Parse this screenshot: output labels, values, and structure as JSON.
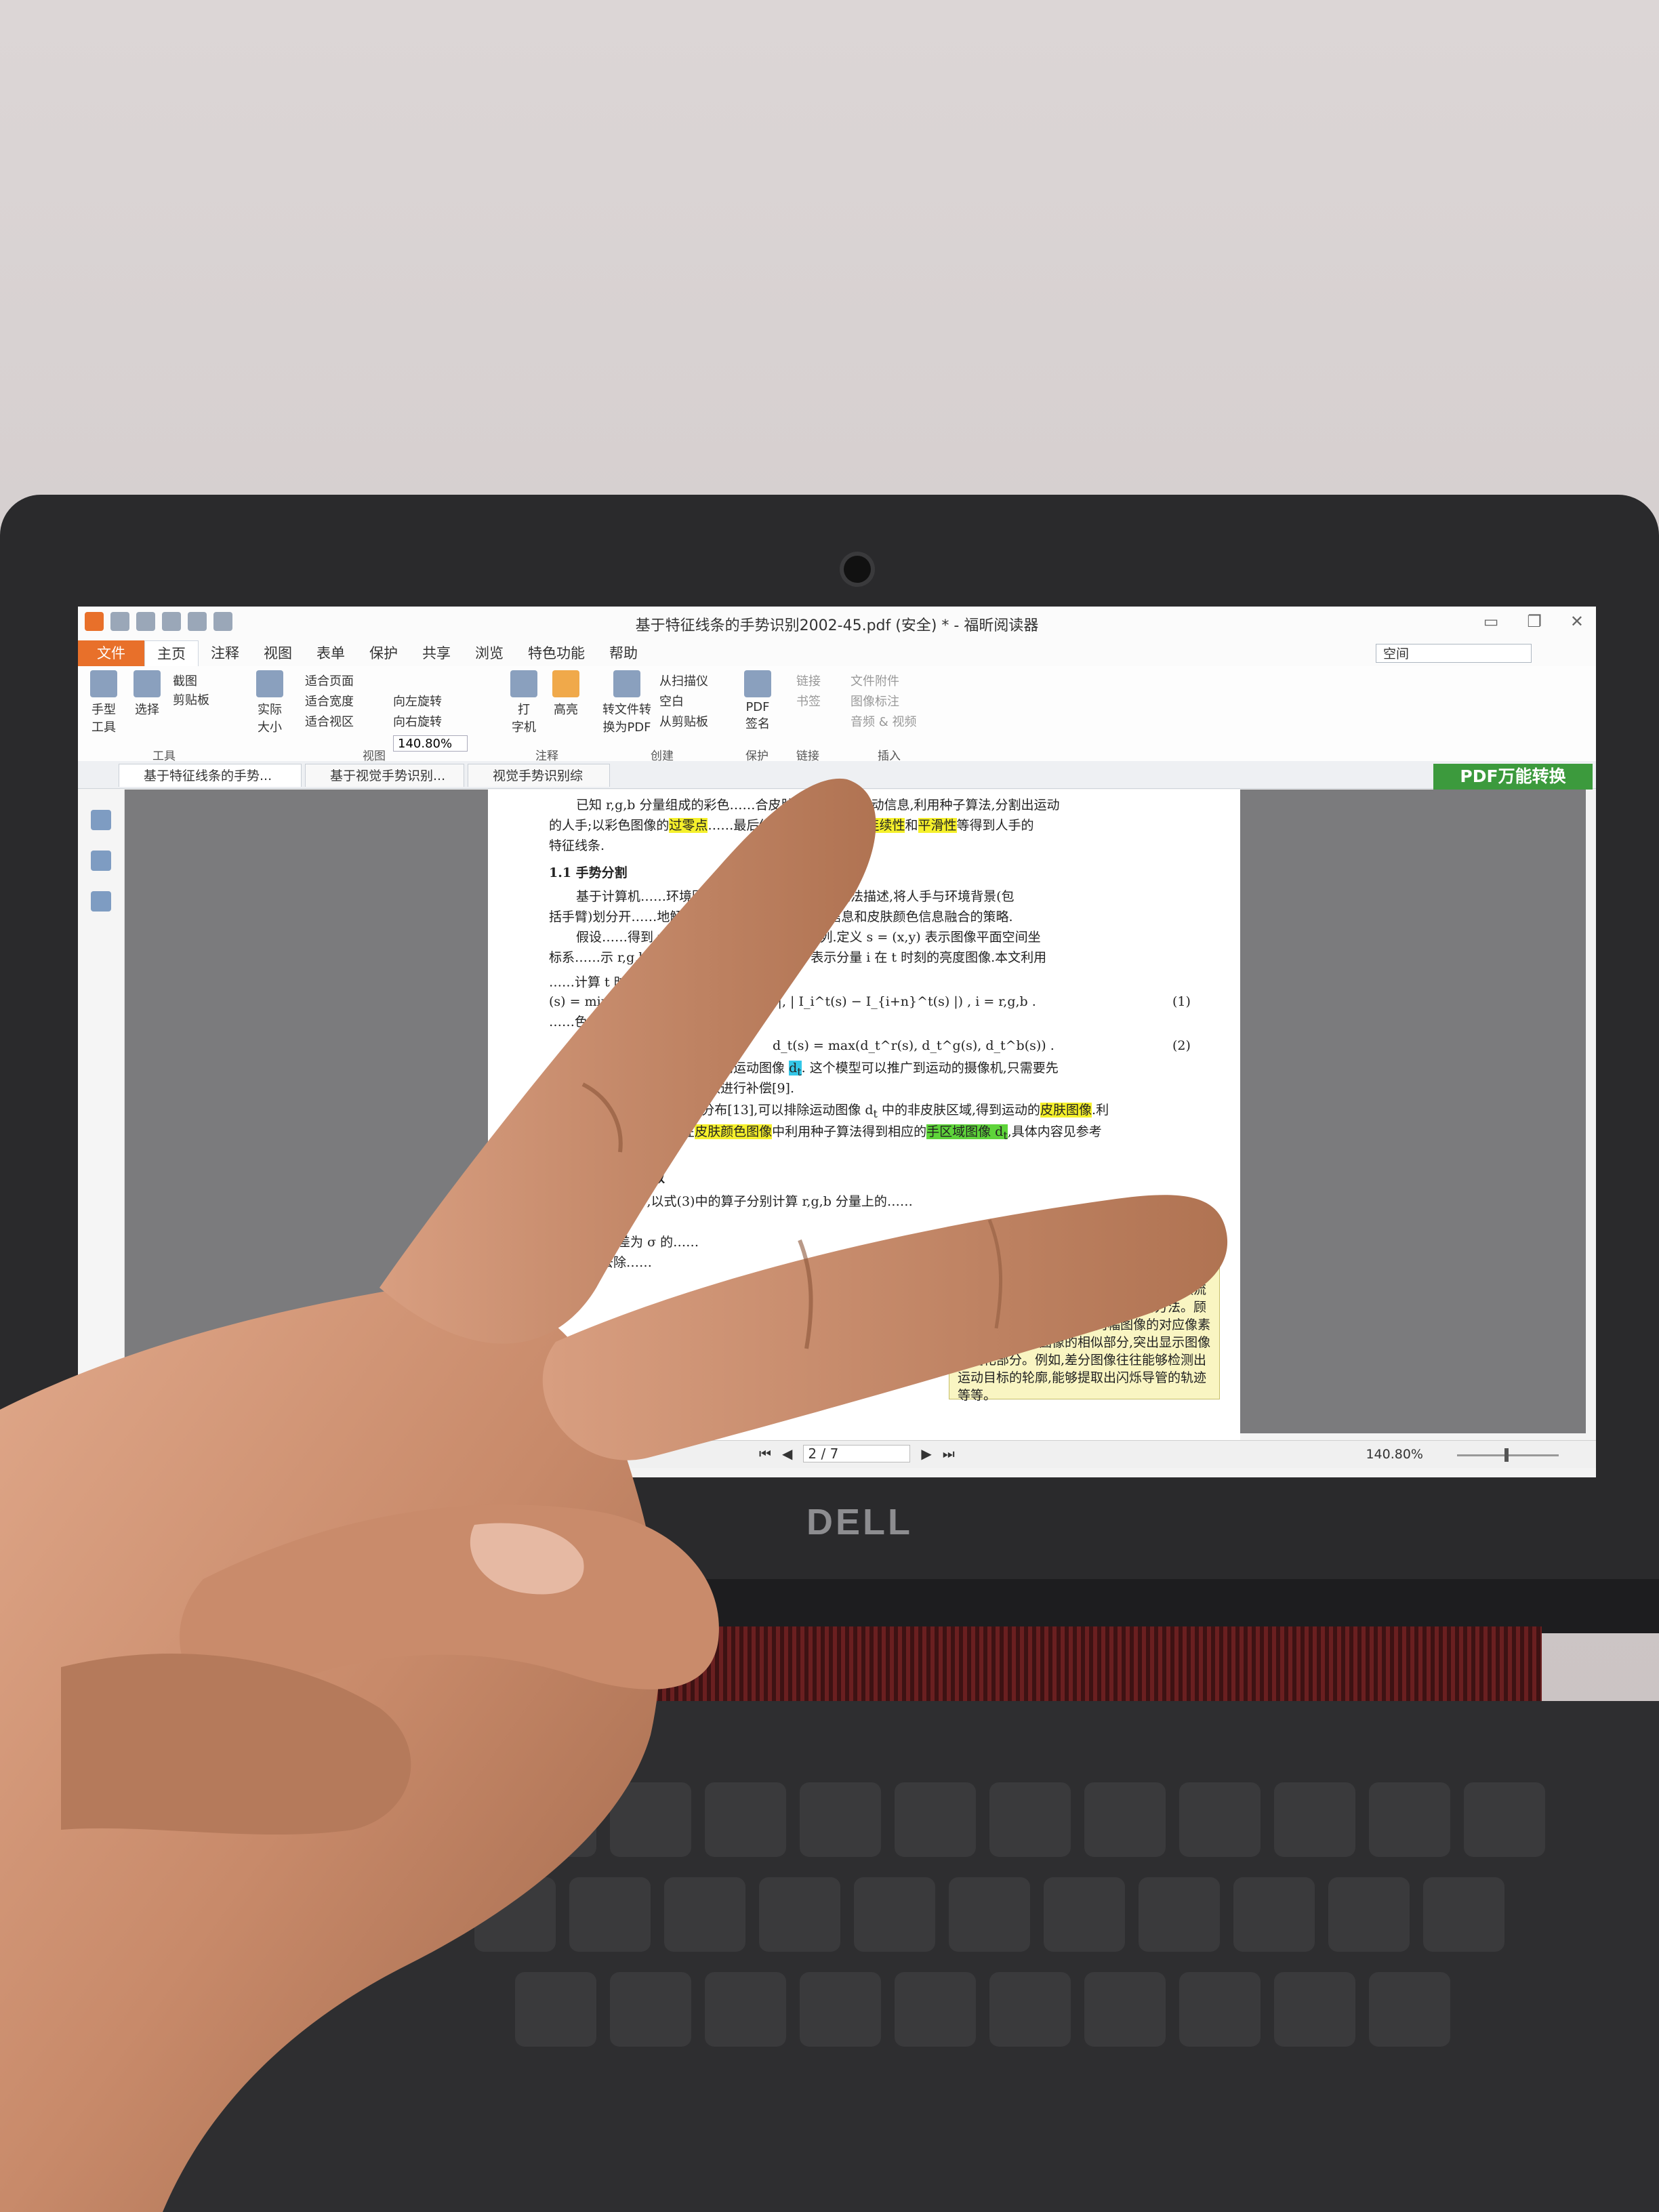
{
  "app": {
    "window_title": "基于特征线条的手势识别2002-45.pdf (安全) * - 福昕阅读器",
    "menu": [
      "文件",
      "主页",
      "注释",
      "视图",
      "表单",
      "保护",
      "共享",
      "浏览",
      "特色功能",
      "帮助"
    ],
    "active_menu": "主页",
    "search_value": "空间",
    "ribbon": {
      "hand_tool": "手型\n工具",
      "select": "选择",
      "snapshot": "截图",
      "clipboard": "剪贴板",
      "tools_group": "工具",
      "actual_size": "实际\n大小",
      "fit_page": "适合页面",
      "fit_width": "适合宽度",
      "fit_visible": "适合视区",
      "zoom_value": "140.80%",
      "rotate_left": "向左旋转",
      "rotate_right": "向右旋转",
      "view_group": "视图",
      "typewriter": "打\n字机",
      "highlight": "高亮",
      "comment_group": "注释",
      "convert": "转文件转\n换为PDF",
      "from_scanner": "从扫描仪",
      "blank": "空白",
      "from_clipboard": "从剪贴板",
      "create_group": "创建",
      "pdf_sign": "PDF\n签名",
      "protect_group": "保护",
      "link": "链接",
      "bookmark": "书签",
      "links_group": "链接",
      "file_attachment": "文件附件",
      "image_annotation": "图像标注",
      "audio_video": "音频 & 视频",
      "insert_group": "插入"
    },
    "tabs": [
      "基于特征线条的手势...",
      "基于视觉手势识别...",
      "视觉手势识别综述-..."
    ],
    "pdf_convert_button": "PDF万能转换",
    "status": {
      "page": "2 / 7",
      "zoom": "140.80%"
    }
  },
  "document": {
    "lines": [
      "已知 r,g,b 分量组成的彩色……合皮肤颜色信息和运动信息,利用种子算法,分割出运动",
      "的人手;以彩色图像的过零点……最后结合两者结果,利用连续性和平滑性等得到人手的",
      "特征线条.",
      "1.1  手势分割",
      "基于计算机……环境因素多种多样,不可预见也无法描述,将人手与环境背景(包",
      "括手臂)划分开……地解决这个问题,我们采用运动信息和皮肤颜色信息融合的策略.",
      "假设……得到 r,g,b 分量组成的彩色图像序列.定义 s = (x,y) 表示图像平面空间坐",
      "标系……示 r,g,b 中任意一个分量.那么 I_i^t 表示分量 i 在 t 时刻的亮度图像.本文利用",
      "……计算 t 时刻 i 分量运动图像 d_i^t 为",
      "(s) = min(| I_i^t(s) − I_{i−n}^t(s) |, | I_i^t(s) − I_{i+n}^t(s) |) , i = r,g,b .",
      "……色序列在 t 时刻的运动图像 d_t 为",
      "d_t(s) = max(d_t^r(s), d_t^g(s), d_t^b(s)) .",
      "……进行平滑和二值化处理,得到运动图像 d_t. 这个模型可以推广到运动的摄像机,只需要先",
      "……体运动,引入一个运动参数进行补偿[9].",
      "……肤颜色在 HLS 空间的分布[13],可以排除运动图像 d_t 中的非皮肤区域,得到运动的皮肤图像.利",
      "……图像得到手的种子,在皮肤颜色图像中利用种子算法得到相应的手区域图像 d_t,具体内容见参考",
      "……边缘信息的获取",
      "……RGB 图像中,以式(3)中的算子分别计算 r,g,b 分量上的……",
      "……,是标准差为 σ 的……",
      "……并且去除……"
    ],
    "eq_numbers": [
      "(1)",
      "(2)"
    ],
    "note": "目标场景在连续时间点图像相……成的图像。在处理图像的时候,特别……处理视频流图像的时候,往往会用到图像差分的方法。顾名思义,图像差分,就是把两幅图像的对应像素值相减,以削弱图像的相似部分,突出显示图像的变化部分。例如,差分图像往往能够检测出运动目标的轮廓,能够提取出闪烁导管的轨迹等等。",
    "note_left": "……本文需要的是"
  },
  "laptop": {
    "brand": "DELL"
  }
}
